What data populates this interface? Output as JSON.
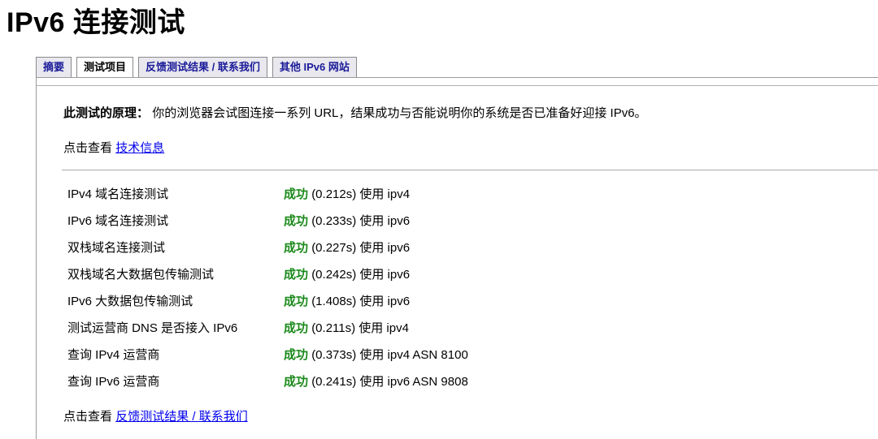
{
  "page": {
    "title": "IPv6 连接测试"
  },
  "tabs": [
    {
      "label": "摘要"
    },
    {
      "label": "测试项目"
    },
    {
      "label": "反馈测试结果 / 联系我们"
    },
    {
      "label": "其他 IPv6 网站"
    }
  ],
  "principle": {
    "label": "此测试的原理：",
    "text": "你的浏览器会试图连接一系列 URL，结果成功与否能说明你的系统是否已准备好迎接 IPv6。"
  },
  "tech": {
    "prefix": "点击查看",
    "link": "技术信息"
  },
  "results": [
    {
      "name": "IPv4 域名连接测试",
      "status": "成功",
      "detail": "(0.212s) 使用 ipv4"
    },
    {
      "name": "IPv6 域名连接测试",
      "status": "成功",
      "detail": "(0.233s) 使用 ipv6"
    },
    {
      "name": "双栈域名连接测试",
      "status": "成功",
      "detail": "(0.227s) 使用 ipv6"
    },
    {
      "name": "双栈域名大数据包传输测试",
      "status": "成功",
      "detail": "(0.242s) 使用 ipv6"
    },
    {
      "name": "IPv6 大数据包传输测试",
      "status": "成功",
      "detail": "(1.408s) 使用 ipv6"
    },
    {
      "name": "测试运营商 DNS 是否接入 IPv6",
      "status": "成功",
      "detail": "(0.211s) 使用 ipv4"
    },
    {
      "name": "查询 IPv4 运营商",
      "status": "成功",
      "detail": "(0.373s) 使用 ipv4 ASN 8100"
    },
    {
      "name": "查询 IPv6 运营商",
      "status": "成功",
      "detail": "(0.241s) 使用 ipv6 ASN 9808"
    }
  ],
  "feedback": {
    "prefix": "点击查看",
    "link": "反馈测试结果 / 联系我们"
  },
  "colors": {
    "success": "#1b8a1b",
    "link": "#0000ee",
    "tab_text": "#1a1a9a"
  }
}
